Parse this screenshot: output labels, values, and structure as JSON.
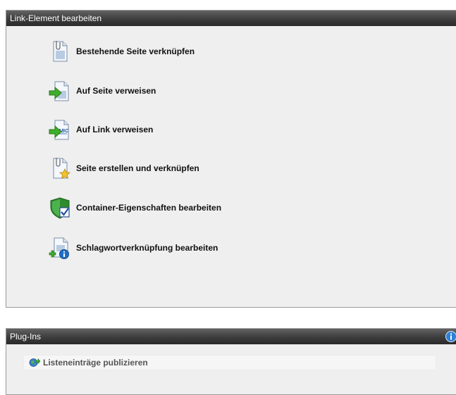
{
  "link_panel": {
    "title": "Link-Element bearbeiten",
    "actions": [
      {
        "label": "Bestehende Seite verknüpfen",
        "icon": "page-clip-icon"
      },
      {
        "label": "Auf Seite verweisen",
        "icon": "page-arrow-icon"
      },
      {
        "label": "Auf Link verweisen",
        "icon": "abc-link-arrow-icon"
      },
      {
        "label": "Seite erstellen und verknüpfen",
        "icon": "page-star-icon"
      },
      {
        "label": "Container-Eigenschaften bearbeiten",
        "icon": "shield-check-icon"
      },
      {
        "label": "Schlagwortverknüpfung bearbeiten",
        "icon": "page-plus-info-icon"
      }
    ]
  },
  "plugin_panel": {
    "title": "Plug-Ins",
    "items": [
      {
        "label": "Listeneinträge publizieren",
        "icon": "globe-publish-icon"
      }
    ]
  },
  "colors": {
    "header_bg": "#3d3d3d",
    "panel_bg": "#efefef",
    "arrow_green": "#3fae2a",
    "shield_green": "#2e8b2e",
    "info_blue": "#1f6fc9",
    "star_yellow": "#f2c230"
  }
}
